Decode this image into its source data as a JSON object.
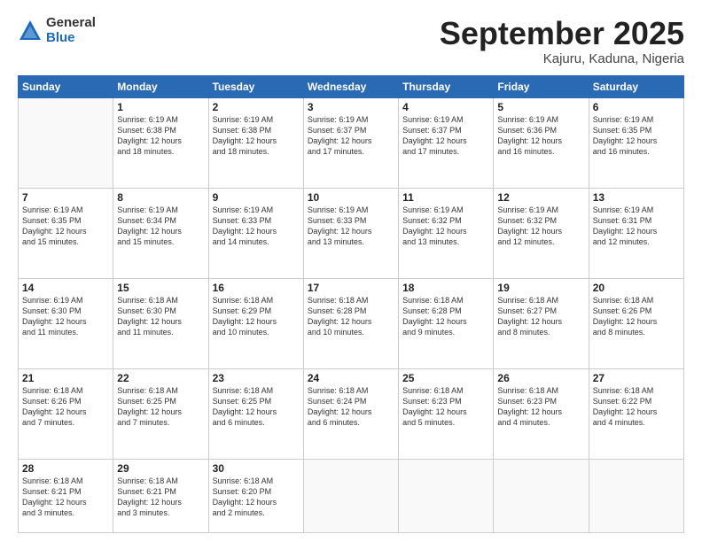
{
  "logo": {
    "general": "General",
    "blue": "Blue"
  },
  "header": {
    "month": "September 2025",
    "location": "Kajuru, Kaduna, Nigeria"
  },
  "weekdays": [
    "Sunday",
    "Monday",
    "Tuesday",
    "Wednesday",
    "Thursday",
    "Friday",
    "Saturday"
  ],
  "weeks": [
    [
      {
        "day": "",
        "info": ""
      },
      {
        "day": "1",
        "info": "Sunrise: 6:19 AM\nSunset: 6:38 PM\nDaylight: 12 hours\nand 18 minutes."
      },
      {
        "day": "2",
        "info": "Sunrise: 6:19 AM\nSunset: 6:38 PM\nDaylight: 12 hours\nand 18 minutes."
      },
      {
        "day": "3",
        "info": "Sunrise: 6:19 AM\nSunset: 6:37 PM\nDaylight: 12 hours\nand 17 minutes."
      },
      {
        "day": "4",
        "info": "Sunrise: 6:19 AM\nSunset: 6:37 PM\nDaylight: 12 hours\nand 17 minutes."
      },
      {
        "day": "5",
        "info": "Sunrise: 6:19 AM\nSunset: 6:36 PM\nDaylight: 12 hours\nand 16 minutes."
      },
      {
        "day": "6",
        "info": "Sunrise: 6:19 AM\nSunset: 6:35 PM\nDaylight: 12 hours\nand 16 minutes."
      }
    ],
    [
      {
        "day": "7",
        "info": "Sunrise: 6:19 AM\nSunset: 6:35 PM\nDaylight: 12 hours\nand 15 minutes."
      },
      {
        "day": "8",
        "info": "Sunrise: 6:19 AM\nSunset: 6:34 PM\nDaylight: 12 hours\nand 15 minutes."
      },
      {
        "day": "9",
        "info": "Sunrise: 6:19 AM\nSunset: 6:33 PM\nDaylight: 12 hours\nand 14 minutes."
      },
      {
        "day": "10",
        "info": "Sunrise: 6:19 AM\nSunset: 6:33 PM\nDaylight: 12 hours\nand 13 minutes."
      },
      {
        "day": "11",
        "info": "Sunrise: 6:19 AM\nSunset: 6:32 PM\nDaylight: 12 hours\nand 13 minutes."
      },
      {
        "day": "12",
        "info": "Sunrise: 6:19 AM\nSunset: 6:32 PM\nDaylight: 12 hours\nand 12 minutes."
      },
      {
        "day": "13",
        "info": "Sunrise: 6:19 AM\nSunset: 6:31 PM\nDaylight: 12 hours\nand 12 minutes."
      }
    ],
    [
      {
        "day": "14",
        "info": "Sunrise: 6:19 AM\nSunset: 6:30 PM\nDaylight: 12 hours\nand 11 minutes."
      },
      {
        "day": "15",
        "info": "Sunrise: 6:18 AM\nSunset: 6:30 PM\nDaylight: 12 hours\nand 11 minutes."
      },
      {
        "day": "16",
        "info": "Sunrise: 6:18 AM\nSunset: 6:29 PM\nDaylight: 12 hours\nand 10 minutes."
      },
      {
        "day": "17",
        "info": "Sunrise: 6:18 AM\nSunset: 6:28 PM\nDaylight: 12 hours\nand 10 minutes."
      },
      {
        "day": "18",
        "info": "Sunrise: 6:18 AM\nSunset: 6:28 PM\nDaylight: 12 hours\nand 9 minutes."
      },
      {
        "day": "19",
        "info": "Sunrise: 6:18 AM\nSunset: 6:27 PM\nDaylight: 12 hours\nand 8 minutes."
      },
      {
        "day": "20",
        "info": "Sunrise: 6:18 AM\nSunset: 6:26 PM\nDaylight: 12 hours\nand 8 minutes."
      }
    ],
    [
      {
        "day": "21",
        "info": "Sunrise: 6:18 AM\nSunset: 6:26 PM\nDaylight: 12 hours\nand 7 minutes."
      },
      {
        "day": "22",
        "info": "Sunrise: 6:18 AM\nSunset: 6:25 PM\nDaylight: 12 hours\nand 7 minutes."
      },
      {
        "day": "23",
        "info": "Sunrise: 6:18 AM\nSunset: 6:25 PM\nDaylight: 12 hours\nand 6 minutes."
      },
      {
        "day": "24",
        "info": "Sunrise: 6:18 AM\nSunset: 6:24 PM\nDaylight: 12 hours\nand 6 minutes."
      },
      {
        "day": "25",
        "info": "Sunrise: 6:18 AM\nSunset: 6:23 PM\nDaylight: 12 hours\nand 5 minutes."
      },
      {
        "day": "26",
        "info": "Sunrise: 6:18 AM\nSunset: 6:23 PM\nDaylight: 12 hours\nand 4 minutes."
      },
      {
        "day": "27",
        "info": "Sunrise: 6:18 AM\nSunset: 6:22 PM\nDaylight: 12 hours\nand 4 minutes."
      }
    ],
    [
      {
        "day": "28",
        "info": "Sunrise: 6:18 AM\nSunset: 6:21 PM\nDaylight: 12 hours\nand 3 minutes."
      },
      {
        "day": "29",
        "info": "Sunrise: 6:18 AM\nSunset: 6:21 PM\nDaylight: 12 hours\nand 3 minutes."
      },
      {
        "day": "30",
        "info": "Sunrise: 6:18 AM\nSunset: 6:20 PM\nDaylight: 12 hours\nand 2 minutes."
      },
      {
        "day": "",
        "info": ""
      },
      {
        "day": "",
        "info": ""
      },
      {
        "day": "",
        "info": ""
      },
      {
        "day": "",
        "info": ""
      }
    ]
  ]
}
